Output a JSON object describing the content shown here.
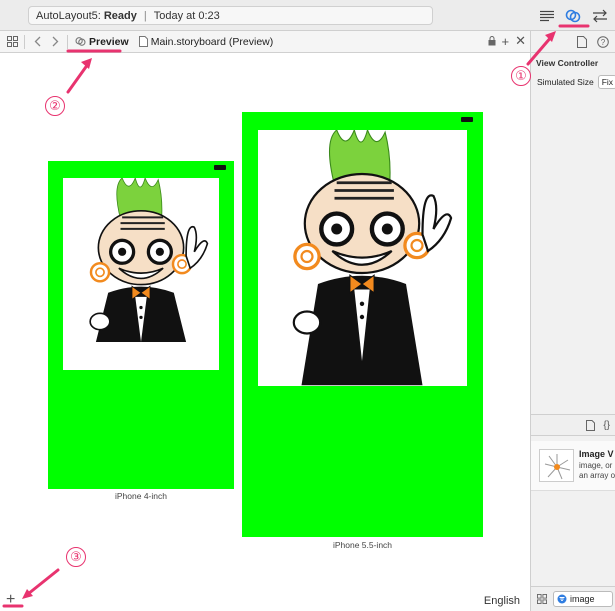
{
  "toolbar": {
    "project": "AutoLayout5:",
    "status": "Ready",
    "separator": "|",
    "timestamp": "Today at 0:23"
  },
  "jumpbar": {
    "crumbs": [
      "Preview",
      "Main.storyboard (Preview)"
    ]
  },
  "canvas": {
    "devices": [
      {
        "label": "iPhone 4-inch"
      },
      {
        "label": "iPhone 5.5-inch"
      }
    ],
    "language": "English"
  },
  "inspector": {
    "section_title": "View Controller",
    "simulated_size_label": "Simulated Size",
    "simulated_size_value": "Fix",
    "library_item_title": "Image V",
    "library_item_desc_line1": "image, or",
    "library_item_desc_line2": "an array o",
    "filter_value": "image"
  },
  "annotations": [
    "①",
    "②",
    "③"
  ],
  "colors": {
    "device_background": "#00ff00",
    "annotation_pink": "#e8336f",
    "assistant_blue": "#2f7de1"
  },
  "icons": [
    "grid-icon",
    "back-icon",
    "forward-icon",
    "preview-icon",
    "storyboard-file-icon",
    "lock-icon",
    "add-icon",
    "close-icon",
    "standard-editor-icon",
    "assistant-editor-icon",
    "version-editor-icon",
    "file-inspector-icon",
    "help-icon",
    "filter-icon"
  ]
}
